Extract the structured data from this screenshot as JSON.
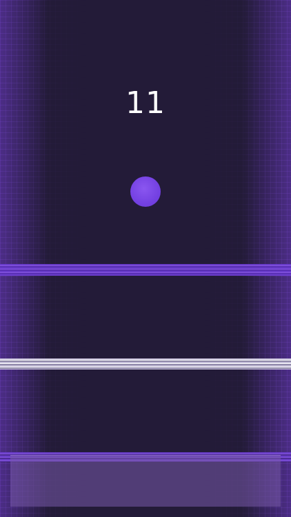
{
  "game": {
    "score": "11"
  },
  "colors": {
    "background": "#231b38",
    "grid": "#8c5ae6",
    "ball": "#7441e2",
    "score_text": "#ffffff",
    "purple_bar": "#6e3fd2",
    "white_bar": "#ffffff",
    "floor_panel": "#785aaa"
  }
}
